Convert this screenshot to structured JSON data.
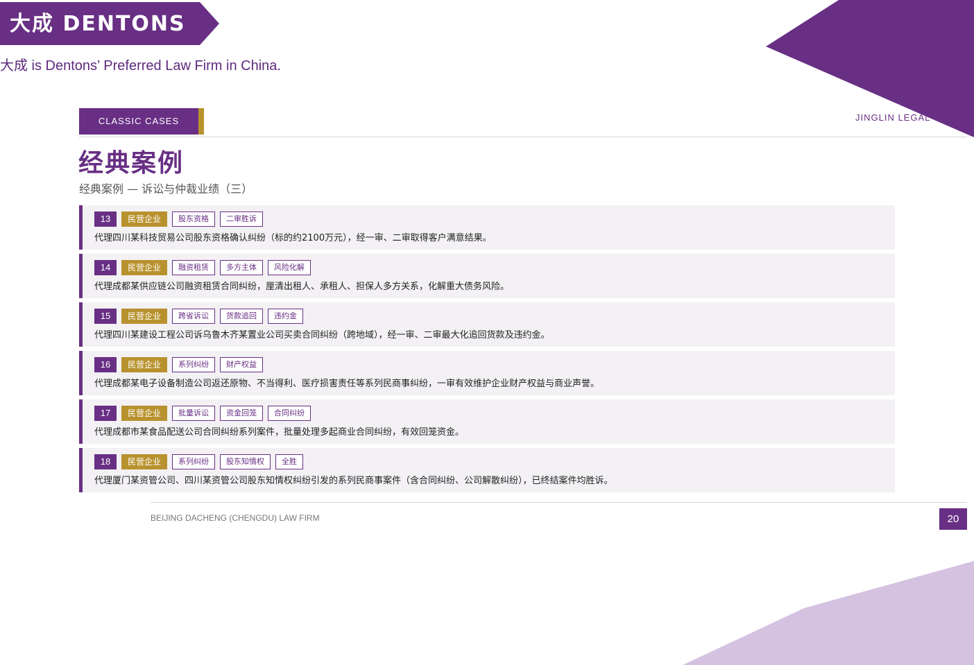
{
  "colors": {
    "brand_purple": "#682f84",
    "gold": "#b8922e",
    "lavender": "#d5c2e0"
  },
  "header": {
    "logo_text": "大成 DENTONS",
    "tagline": "大成 is Dentons’ Preferred Law Firm in China.",
    "section_badge": "CLASSIC CASES",
    "team_label": "JINGLIN LEGAL TEAM"
  },
  "title": "经典案例",
  "subtitle": "经典案例 — 诉讼与仲裁业绩（三）",
  "cases": [
    {
      "num": "13",
      "category": "民营企业",
      "tags": [
        "股东资格",
        "二审胜诉"
      ],
      "desc": "代理四川某科技贸易公司股东资格确认纠纷（标的约2100万元），经一审、二审取得客户满意结果。"
    },
    {
      "num": "14",
      "category": "民营企业",
      "tags": [
        "融资租赁",
        "多方主体",
        "风险化解"
      ],
      "desc": "代理成都某供应链公司融资租赁合同纠纷，厘清出租人、承租人、担保人多方关系，化解重大债务风险。"
    },
    {
      "num": "15",
      "category": "民营企业",
      "tags": [
        "跨省诉讼",
        "货款追回",
        "违约金"
      ],
      "desc": "代理四川某建设工程公司诉乌鲁木齐某置业公司买卖合同纠纷（跨地域），经一审、二审最大化追回货款及违约金。"
    },
    {
      "num": "16",
      "category": "民营企业",
      "tags": [
        "系列纠纷",
        "财产权益"
      ],
      "desc": "代理成都某电子设备制造公司返还原物、不当得利、医疗损害责任等系列民商事纠纷，一审有效维护企业财产权益与商业声誉。"
    },
    {
      "num": "17",
      "category": "民营企业",
      "tags": [
        "批量诉讼",
        "资金回笼",
        "合同纠纷"
      ],
      "desc": "代理成都市某食品配送公司合同纠纷系列案件，批量处理多起商业合同纠纷，有效回笼资金。"
    },
    {
      "num": "18",
      "category": "民营企业",
      "tags": [
        "系列纠纷",
        "股东知情权",
        "全胜"
      ],
      "desc": "代理厦门某资管公司、四川某资管公司股东知情权纠纷引发的系列民商事案件（含合同纠纷、公司解散纠纷），已终结案件均胜诉。"
    }
  ],
  "footer": {
    "firm": "BEIJING DACHENG (CHENGDU) LAW FIRM",
    "page_number": "20"
  }
}
